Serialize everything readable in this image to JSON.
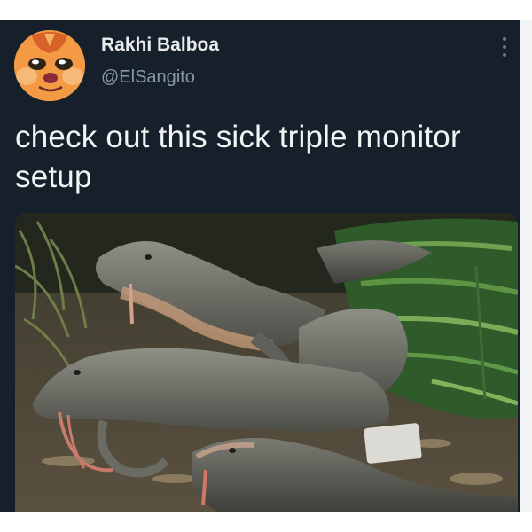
{
  "tweet": {
    "display_name": "Rakhi Balboa",
    "handle": "@ElSangito",
    "text": "check out this sick triple monitor setup",
    "avatar_icon": "orange-cartoon-avatar",
    "menu_icon": "more-vertical-icon",
    "media_description": "three monitor lizards lying on forest floor with ferns"
  },
  "colors": {
    "background": "#15202b",
    "name": "#e7e9ea",
    "handle": "#8b98a5",
    "text": "#f1f3f4"
  }
}
